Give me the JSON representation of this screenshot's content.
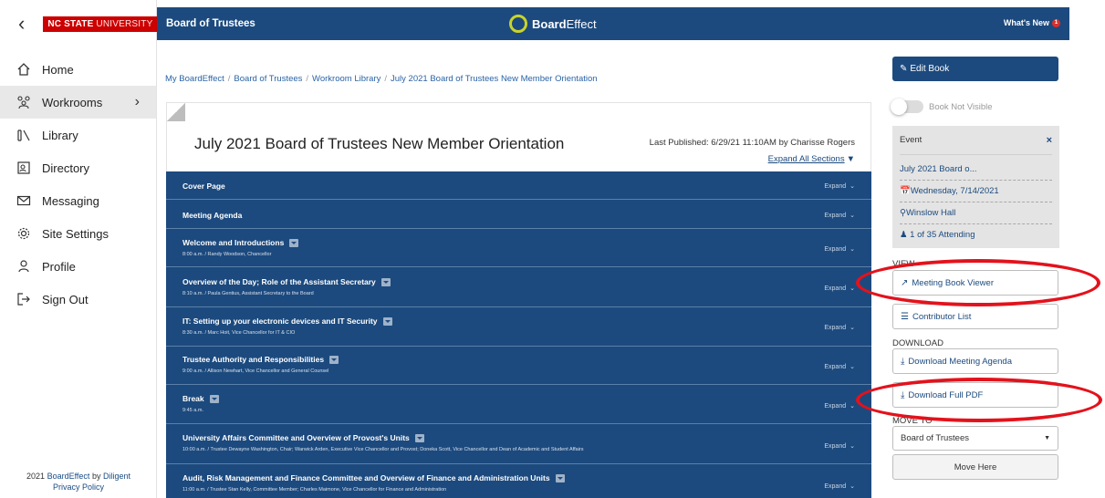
{
  "sidebar": {
    "logo": {
      "bold": "NC STATE",
      "light": " UNIVERSITY"
    },
    "items": [
      {
        "label": "Home",
        "icon": "home-icon"
      },
      {
        "label": "Workrooms",
        "icon": "workrooms-icon",
        "active": true
      },
      {
        "label": "Library",
        "icon": "library-icon"
      },
      {
        "label": "Directory",
        "icon": "directory-icon"
      },
      {
        "label": "Messaging",
        "icon": "envelope-icon"
      },
      {
        "label": "Site Settings",
        "icon": "gear-icon"
      },
      {
        "label": "Profile",
        "icon": "user-icon"
      },
      {
        "label": "Sign Out",
        "icon": "sign-out-icon"
      }
    ],
    "footer": {
      "year": "2021",
      "brand": "BoardEffect",
      "by": " by ",
      "company": "Diligent",
      "privacy": "Privacy Policy"
    }
  },
  "header": {
    "title": "Board of Trustees",
    "brand_bold": "Board",
    "brand_light": "Effect",
    "whats_new": "What's New",
    "badge": "1"
  },
  "breadcrumb": [
    "My BoardEffect",
    "Board of Trustees",
    "Workroom Library",
    "July 2021 Board of Trustees New Member Orientation"
  ],
  "book": {
    "title": "July 2021 Board of Trustees New Member Orientation",
    "published": "Last Published: 6/29/21 11:10AM by Charisse Rogers",
    "expand_all": "Expand All Sections",
    "expand_label": "Expand",
    "sections": [
      {
        "title": "Cover Page",
        "sub": "",
        "has_toggle": false
      },
      {
        "title": "Meeting Agenda",
        "sub": "",
        "has_toggle": false
      },
      {
        "title": "Welcome and Introductions",
        "sub": "8:00 a.m. / Randy Woodson, Chancellor",
        "has_toggle": true
      },
      {
        "title": "Overview of the Day; Role of the Assistant Secretary",
        "sub": "8:10 a.m. / Paula Gentius, Assistant Secretary to the Board",
        "has_toggle": true
      },
      {
        "title": "IT: Setting up your electronic devices and IT Security",
        "sub": "8:30 a.m. / Marc Hoit, Vice Chancellor for IT & CIO",
        "has_toggle": true
      },
      {
        "title": "Trustee Authority and Responsibilities",
        "sub": "9:00 a.m. / Allison Newhart, Vice Chancellor and General Counsel",
        "has_toggle": true
      },
      {
        "title": "Break",
        "sub": "9:45 a.m.",
        "has_toggle": true
      },
      {
        "title": "University Affairs Committee and Overview of Provost's Units",
        "sub": "10:00 a.m. / Trustee Dewayne Washington, Chair; Warwick Arden, Executive Vice Chancellor and Provost; Doneka Scott, Vice Chancellor and Dean of Academic and Student Affairs",
        "has_toggle": true
      },
      {
        "title": "Audit, Risk Management and Finance Committee and Overview of Finance and Administration Units",
        "sub": "11:00 a.m. / Trustee Stan Kelly, Committee Member; Charles Maimone, Vice Chancellor for Finance and Administration",
        "has_toggle": true
      }
    ]
  },
  "right_panel": {
    "edit_book": "Edit Book",
    "visibility": "Book Not Visible",
    "event": {
      "header": "Event",
      "name": "July 2021 Board o...",
      "date": "Wednesday, 7/14/2021",
      "location": "Winslow Hall",
      "attending": "1 of 35 Attending"
    },
    "view_label": "VIEW",
    "meeting_book_viewer": "Meeting Book Viewer",
    "contributor_list": "Contributor List",
    "download_label": "DOWNLOAD",
    "download_agenda": "Download Meeting Agenda",
    "download_pdf": "Download Full PDF",
    "move_label": "MOVE TO",
    "move_select": "Board of Trustees",
    "move_here": "Move Here"
  },
  "colors": {
    "primary": "#1c4a7e",
    "highlight": "#e3121c",
    "ncsu_red": "#cc0000"
  }
}
